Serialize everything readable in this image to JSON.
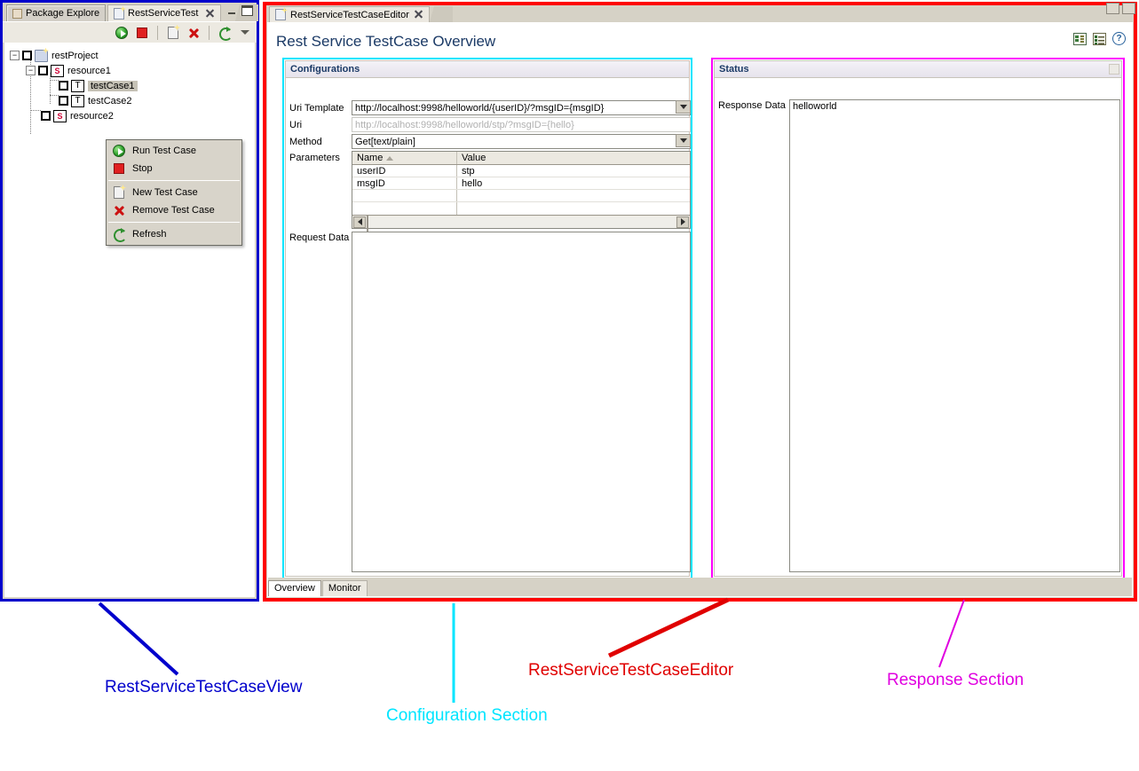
{
  "window": {
    "minimize_label": "minimize",
    "maximize_label": "maximize"
  },
  "view_panel": {
    "tabs": [
      {
        "label": "Package Explore",
        "icon": "package-explorer-icon",
        "active": false
      },
      {
        "label": "RestServiceTest",
        "icon": "rest-service-test-icon",
        "active": true
      }
    ],
    "toolbar": [
      {
        "name": "run-button",
        "icon": "run-icon"
      },
      {
        "name": "stop-button",
        "icon": "stop-icon"
      },
      {
        "name": "new-test-case-button",
        "icon": "new-file-icon"
      },
      {
        "name": "remove-test-case-button",
        "icon": "red-x-icon"
      },
      {
        "name": "refresh-button",
        "icon": "refresh-icon"
      },
      {
        "name": "view-menu-button",
        "icon": "chevron-down-icon"
      }
    ],
    "tree": [
      {
        "label": "restProject",
        "icon": "project-icon",
        "level": 0,
        "expander": "-",
        "selected": false
      },
      {
        "label": "resource1",
        "icon": "s-icon",
        "level": 1,
        "expander": "-",
        "selected": false
      },
      {
        "label": "testCase1",
        "icon": "t-icon",
        "level": 2,
        "expander": "",
        "selected": true
      },
      {
        "label": "testCase2",
        "icon": "t-icon",
        "level": 2,
        "expander": "",
        "selected": false
      },
      {
        "label": "resource2",
        "icon": "s-icon",
        "level": 1,
        "expander": "",
        "selected": false
      }
    ]
  },
  "context_menu": {
    "items": [
      {
        "label": "Run Test Case",
        "icon": "run-icon",
        "separator_after": false
      },
      {
        "label": "Stop",
        "icon": "stop-icon",
        "separator_after": true
      },
      {
        "label": "New Test Case",
        "icon": "new-file-icon",
        "separator_after": false
      },
      {
        "label": "Remove Test Case",
        "icon": "red-x-icon",
        "separator_after": true
      },
      {
        "label": "Refresh",
        "icon": "refresh-icon",
        "separator_after": false
      }
    ]
  },
  "editor": {
    "tab": {
      "label": "RestServiceTestCaseEditor",
      "icon": "editor-file-icon",
      "close_icon": "close-icon"
    },
    "title": "Rest Service TestCase Overview",
    "tools": [
      {
        "name": "form-layout-button",
        "icon": "grid-layout-icon"
      },
      {
        "name": "list-layout-button",
        "icon": "list-layout-icon"
      },
      {
        "name": "help-button",
        "icon": "help-icon"
      }
    ],
    "bottom_tabs": [
      {
        "label": "Overview",
        "active": true
      },
      {
        "label": "Monitor",
        "active": false
      }
    ]
  },
  "configurations": {
    "title": "Configurations",
    "uri_template": {
      "label": "Uri Template",
      "value": "http://localhost:9998/helloworld/{userID}/?msgID={msgID}",
      "dropdown_icon": "chevron-down-icon"
    },
    "uri": {
      "label": "Uri",
      "value": "",
      "placeholder": "http://localhost:9998/helloworld/stp/?msgID={hello}"
    },
    "method": {
      "label": "Method",
      "value": "Get[text/plain]",
      "dropdown_icon": "chevron-down-icon"
    },
    "parameters": {
      "label": "Parameters",
      "columns": [
        "Name",
        "Value"
      ],
      "sorted_column": "Name",
      "sort_direction": "ascending",
      "rows": [
        {
          "name": "userID",
          "value": "stp"
        },
        {
          "name": "msgID",
          "value": "hello"
        },
        {
          "name": "",
          "value": ""
        },
        {
          "name": "",
          "value": ""
        }
      ],
      "scrollbar": {
        "left_icon": "arrow-left-icon",
        "right_icon": "arrow-right-icon"
      }
    },
    "request_data": {
      "label": "Request Data",
      "value": ""
    }
  },
  "status": {
    "title": "Status",
    "response_data": {
      "label": "Response Data",
      "value": "helloworld"
    }
  },
  "annotations": [
    {
      "id": "view",
      "text": "RestServiceTestCaseView",
      "color": "#0000cc"
    },
    {
      "id": "config",
      "text": "Configuration Section",
      "color": "#00e5ff"
    },
    {
      "id": "editor",
      "text": "RestServiceTestCaseEditor",
      "color": "#e00000"
    },
    {
      "id": "response",
      "text": "Response Section",
      "color": "#e000e0"
    }
  ],
  "colors": {
    "view_frame": "#0000cc",
    "editor_frame": "#ff0000",
    "config_frame": "#00e5ff",
    "status_frame": "#ff00ff"
  }
}
